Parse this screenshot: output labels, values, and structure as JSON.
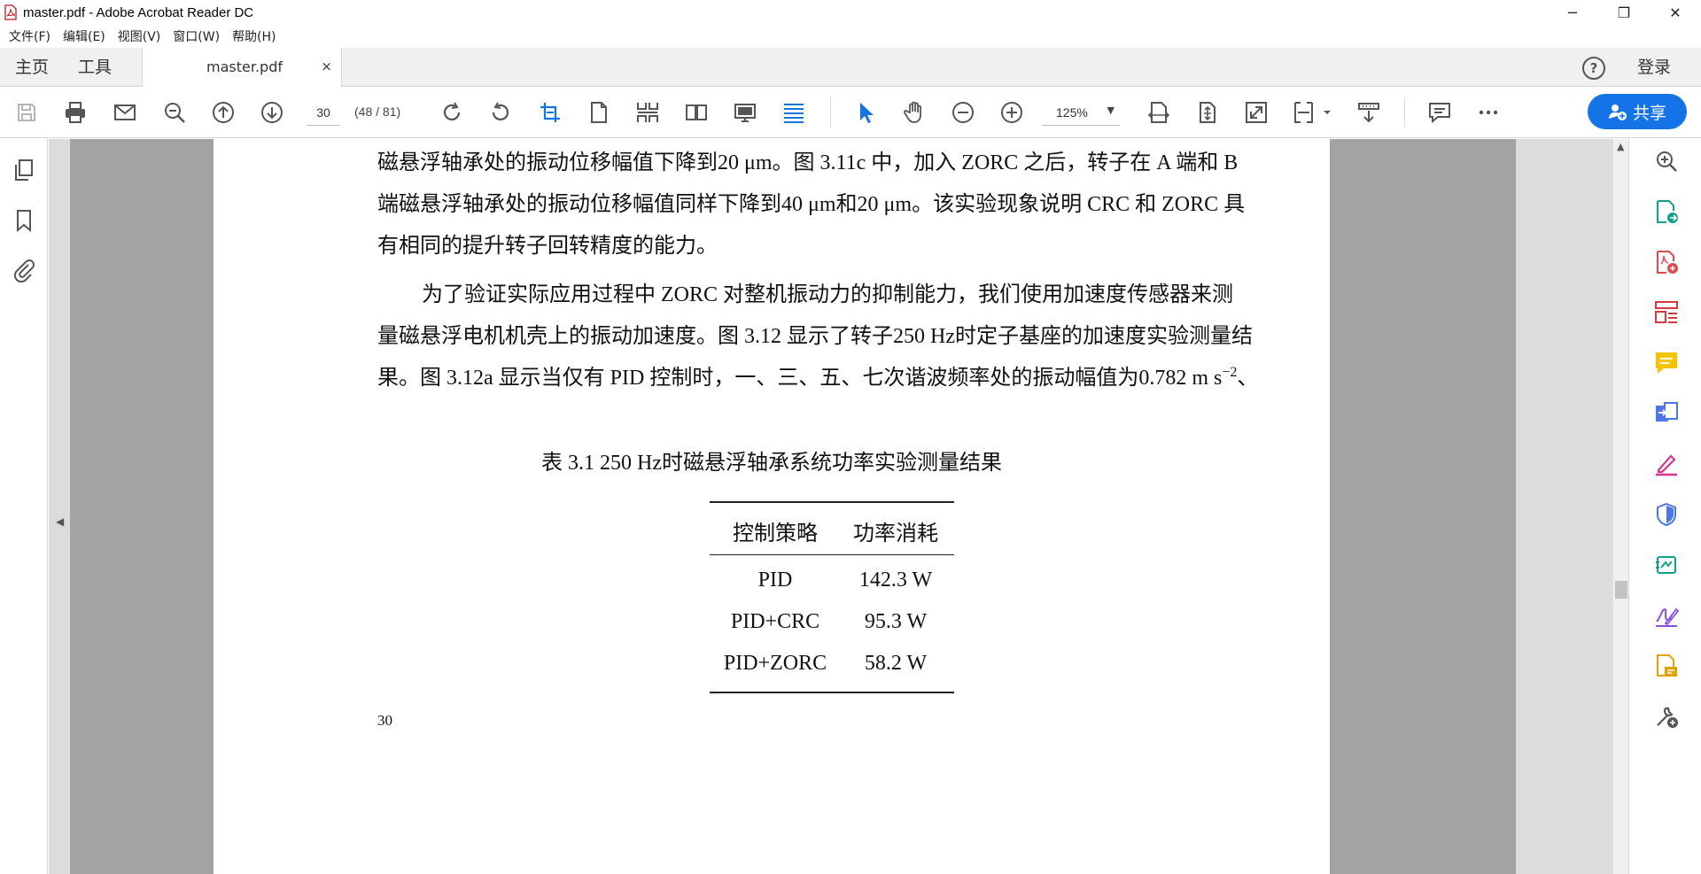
{
  "window": {
    "title": "master.pdf - Adobe Acrobat Reader DC",
    "minimize": "─",
    "restore": "❐",
    "close": "✕"
  },
  "menu": [
    "文件(F)",
    "编辑(E)",
    "视图(V)",
    "窗口(W)",
    "帮助(H)"
  ],
  "tabs": {
    "home": "主页",
    "tools": "工具",
    "document": "master.pdf",
    "close": "×",
    "help": "?",
    "login": "登录"
  },
  "toolbar": {
    "page_value": "30",
    "page_count": "(48 / 81)",
    "zoom_value": "125%",
    "share_label": "共享",
    "accent_color": "#1473e6",
    "icons": [
      "save-icon",
      "print-icon",
      "email-icon",
      "zoom-search-icon",
      "page-up-icon",
      "page-down-icon",
      "rotate-clockwise-icon",
      "rotate-counterclockwise-icon",
      "crop-icon",
      "single-page-icon",
      "two-page-scroll-icon",
      "two-page-icon",
      "presentation-icon",
      "continuous-scroll-icon",
      "select-pointer-icon",
      "hand-icon",
      "zoom-out-icon",
      "zoom-in-icon",
      "fit-width-icon",
      "fit-page-icon",
      "full-screen-icon",
      "page-display-icon",
      "read-aloud-icon",
      "comment-icon",
      "more-icon"
    ]
  },
  "document": {
    "lines": [
      "磁悬浮轴承处的振动位移幅值下降到20 μm。图 3.11c 中，加入 ZORC 之后，转子在 A 端和 B",
      "端磁悬浮轴承处的振动位移幅值同样下降到40 μm和20 μm。该实验现象说明 CRC 和 ZORC 具",
      "有相同的提升转子回转精度的能力。",
      "为了验证实际应用过程中 ZORC 对整机振动力的抑制能力，我们使用加速度传感器来测",
      "量磁悬浮电机机壳上的振动加速度。图 3.12 显示了转子250 Hz时定子基座的加速度实验测量结",
      "果。图 3.12a 显示当仅有 PID 控制时，一、三、五、七次谐波频率处的振动幅值为0.782 m s",
      "−2",
      "、"
    ],
    "table": {
      "caption": "表 3.1    250 Hz时磁悬浮轴承系统功率实验测量结果",
      "headers": [
        "控制策略",
        "功率消耗"
      ],
      "rows": [
        [
          "PID",
          "142.3 W"
        ],
        [
          "PID+CRC",
          "95.3 W"
        ],
        [
          "PID+ZORC",
          "58.2 W"
        ]
      ]
    },
    "page_number": "30"
  },
  "right_tools": [
    "enhance-scan-icon",
    "export-pdf-icon",
    "create-pdf-icon",
    "organize-pages-icon",
    "comment-tool-icon",
    "combine-files-icon",
    "fill-sign-icon",
    "protect-icon",
    "send-for-signature-icon",
    "sign-icon",
    "request-signature-icon",
    "more-tools-icon"
  ]
}
